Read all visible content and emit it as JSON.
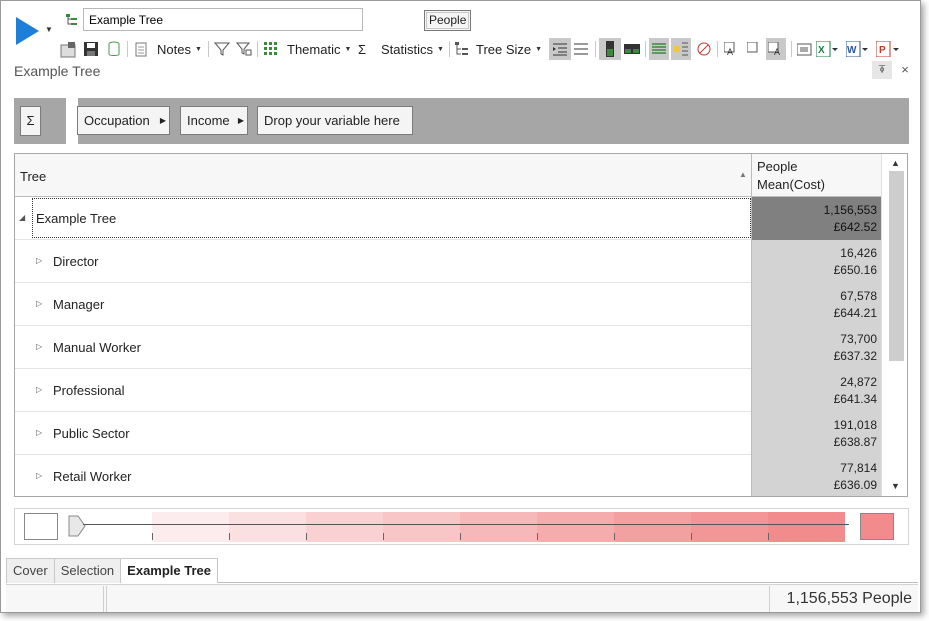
{
  "toolbar": {
    "tree_name_value": "Example Tree",
    "people_label": "People",
    "notes_label": "Notes",
    "thematic_label": "Thematic",
    "statistics_label": "Statistics",
    "tree_size_label": "Tree Size"
  },
  "pane": {
    "title": "Example Tree",
    "pin_glyph": "⍕",
    "close_glyph": "×"
  },
  "variable_bar": {
    "sigma_label": "Σ",
    "chips": [
      "Occupation",
      "Income",
      "Drop your variable here"
    ]
  },
  "grid": {
    "tree_header": "Tree",
    "column_header_line1": "People",
    "column_header_line2": "Mean(Cost)",
    "rows": [
      {
        "label": "Example Tree",
        "count": "1,156,553",
        "mean": "£642.52",
        "level": 0,
        "expanded": true
      },
      {
        "label": "Director",
        "count": "16,426",
        "mean": "£650.16",
        "level": 1,
        "expanded": false
      },
      {
        "label": "Manager",
        "count": "67,578",
        "mean": "£644.21",
        "level": 1,
        "expanded": false
      },
      {
        "label": "Manual Worker",
        "count": "73,700",
        "mean": "£637.32",
        "level": 1,
        "expanded": false
      },
      {
        "label": "Professional",
        "count": "24,872",
        "mean": "£641.34",
        "level": 1,
        "expanded": false
      },
      {
        "label": "Public Sector",
        "count": "191,018",
        "mean": "£638.87",
        "level": 1,
        "expanded": false
      },
      {
        "label": "Retail Worker",
        "count": "77,814",
        "mean": "£636.09",
        "level": 1,
        "expanded": false
      }
    ]
  },
  "legend": {
    "low_color": "#ffffff",
    "high_color": "#f28b8b",
    "bands": [
      "#fdeced",
      "#fbe0e1",
      "#f9d1d2",
      "#f8c6c7",
      "#f6b8b9",
      "#f5acad",
      "#f3a0a1",
      "#f29697",
      "#f18b8c"
    ]
  },
  "tabs": [
    {
      "label": "Cover",
      "active": false
    },
    {
      "label": "Selection",
      "active": false
    },
    {
      "label": "Example Tree",
      "active": true
    }
  ],
  "status": {
    "summary": "1,156,553 People"
  },
  "colors": {
    "accent_blue": "#1e7fd8",
    "root_cell": "#808080",
    "child_cell": "#d3d3d3",
    "variable_bar": "#a6a6a6"
  }
}
